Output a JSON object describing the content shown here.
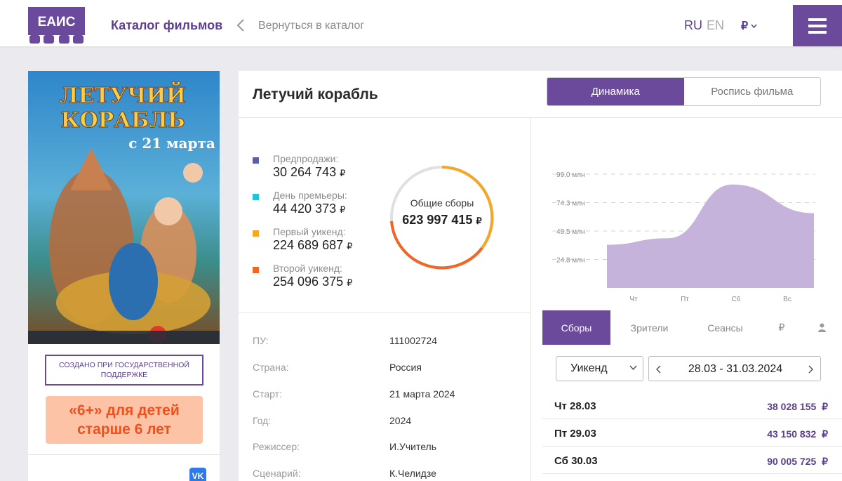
{
  "header": {
    "logo_text": "ЕАИС",
    "catalog_link": "Каталог фильмов",
    "back_link": "Вернуться в каталог",
    "lang_ru": "RU",
    "lang_en": "EN",
    "currency": "₽"
  },
  "left": {
    "gov_support": "СОЗДАНО ПРИ ГОСУДАРСТВЕННОЙ ПОДДЕРЖКЕ",
    "age_rating": "«6+» для детей старше 6 лет",
    "vk_label": "VK"
  },
  "film": {
    "title": "Летучий корабль"
  },
  "top_tabs": [
    "Динамика",
    "Роспись фильма"
  ],
  "stats": [
    {
      "label": "Предпродажи:",
      "value": "30 264 743",
      "color": "#5b5fa8"
    },
    {
      "label": "День премьеры:",
      "value": "44 420 373",
      "color": "#20c4d6"
    },
    {
      "label": "Первый уикенд:",
      "value": "224 689 687",
      "color": "#f5a623"
    },
    {
      "label": "Второй уикенд:",
      "value": "254 096 375",
      "color": "#f26522"
    }
  ],
  "rub": "₽",
  "total": {
    "label": "Общие сборы",
    "value": "623 997 415"
  },
  "info": [
    {
      "key": "ПУ:",
      "value": "111002724"
    },
    {
      "key": "Страна:",
      "value": "Россия"
    },
    {
      "key": "Старт:",
      "value": "21 марта 2024"
    },
    {
      "key": "Год:",
      "value": "2024"
    },
    {
      "key": "Режиссер:",
      "value": "И.Учитель"
    },
    {
      "key": "Сценарий:",
      "value": "К.Челидзе"
    }
  ],
  "chart_data": {
    "type": "area",
    "x": [
      "Чт",
      "Пт",
      "Сб",
      "Вс"
    ],
    "values": [
      37.5,
      43.2,
      90.0,
      65.0
    ],
    "y_ticks": [
      "24.8 млн",
      "49.5 млн",
      "74.3 млн",
      "99.0 млн"
    ],
    "ylim": [
      0,
      110
    ],
    "grid": true,
    "color": "#c6b3dc"
  },
  "stats_tabs": [
    "Сборы",
    "Зрители",
    "Сеансы",
    "₽",
    "person-icon"
  ],
  "period_select": "Уикенд",
  "date_range": "28.03 - 31.03.2024",
  "daily": [
    {
      "day": "Чт 28.03",
      "amount": "38 028 155"
    },
    {
      "day": "Пт 29.03",
      "amount": "43 150 832"
    },
    {
      "day": "Сб 30.03",
      "amount": "90 005 725"
    }
  ],
  "colors": {
    "accent": "#6b4a9b",
    "donut_gray": "#e0e0e0",
    "donut_yellow": "#f5a623",
    "donut_orange": "#f26522"
  }
}
